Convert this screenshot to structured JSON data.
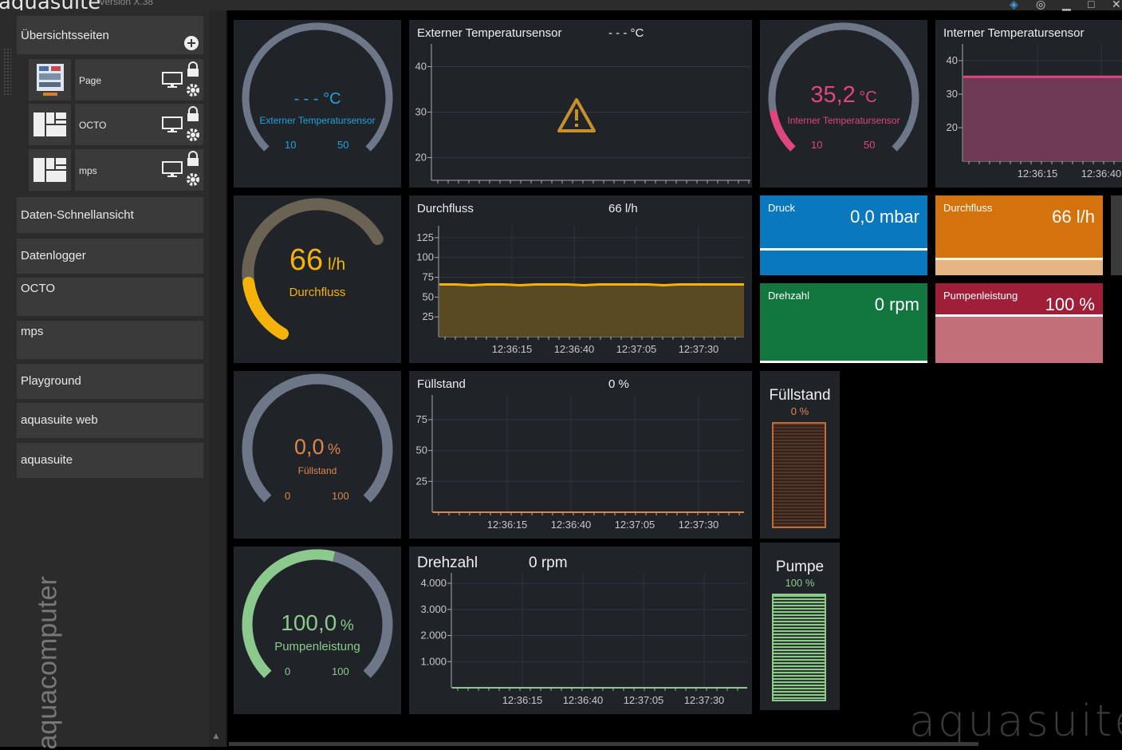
{
  "app": {
    "title": "aquasuite",
    "version": "Version X.38",
    "brand_bottom": "aquasuite",
    "brand_vertical": "aquacomputer"
  },
  "sidebar": {
    "overview_label": "Übersichtsseiten",
    "pages": [
      {
        "label": "Page"
      },
      {
        "label": "OCTO"
      },
      {
        "label": "mps"
      }
    ],
    "items": [
      {
        "label": "Daten-Schnellansicht"
      },
      {
        "label": "Datenlogger"
      },
      {
        "label": "OCTO"
      },
      {
        "label": "mps"
      },
      {
        "label": "Playground"
      },
      {
        "label": "aquasuite web"
      },
      {
        "label": "aquasuite"
      }
    ]
  },
  "gauges": {
    "ext": {
      "value": "- - -",
      "unit": "°C",
      "label": "Externer Temperatursensor",
      "min": "10",
      "max": "50",
      "color": "#1fa3e0"
    },
    "int": {
      "value": "35,2",
      "unit": "°C",
      "label": "Interner Temperatursensor",
      "min": "10",
      "max": "50",
      "color": "#e0457e",
      "fraction": 0.13
    },
    "flow": {
      "value": "66",
      "unit": "l/h",
      "label": "Durchfluss",
      "color": "#f5b20b",
      "fraction": 0.25
    },
    "fill": {
      "value": "0,0",
      "unit": "%",
      "label": "Füllstand",
      "min": "0",
      "max": "100",
      "color": "#e0854a",
      "fraction": 0.0
    },
    "pump": {
      "value": "100,0",
      "unit": "%",
      "label": "Pumpenleistung",
      "min": "0",
      "max": "100",
      "color": "#8cc98c",
      "fraction": 0.55
    }
  },
  "charts": {
    "ext": {
      "title": "Externer Temperatursensor",
      "value": "- - - °C"
    },
    "int": {
      "title": "Interner Temperatursensor"
    },
    "flow": {
      "title": "Durchfluss",
      "value": "66 l/h"
    },
    "fill": {
      "title": "Füllstand",
      "value": "0 %"
    },
    "rpm": {
      "title": "Drehzahl",
      "value": "0 rpm"
    }
  },
  "tiles": {
    "pressure": {
      "label": "Druck",
      "value": "0,0 mbar",
      "color": "#0a78be"
    },
    "flow": {
      "label": "Durchfluss",
      "value": "66 l/h",
      "color": "#d4720b"
    },
    "rpm": {
      "label": "Drehzahl",
      "value": "0 rpm",
      "color": "#12773f"
    },
    "pump": {
      "label": "Pumpenleistung",
      "value": "100 %",
      "color": "#a01f38"
    }
  },
  "bars": {
    "fill": {
      "title": "Füllstand",
      "value": "0 %",
      "color": "#e0854a"
    },
    "pump": {
      "title": "Pumpe",
      "value": "100 %",
      "color": "#8cc98c"
    }
  },
  "chart_data": [
    {
      "type": "line",
      "title": "Externer Temperatursensor",
      "ylim": [
        15,
        45
      ],
      "yticks": [
        20,
        30,
        40
      ],
      "series": [],
      "annotation": "warning (no data)"
    },
    {
      "type": "area",
      "title": "Interner Temperatursensor",
      "x": [
        "12:36:15",
        "12:36:40"
      ],
      "ylim": [
        10,
        45
      ],
      "yticks": [
        20,
        30,
        40
      ],
      "series": [
        {
          "values": [
            35.2,
            35.2,
            35.2,
            35.2,
            35.2
          ]
        }
      ]
    },
    {
      "type": "area",
      "title": "Durchfluss",
      "x": [
        "12:36:15",
        "12:36:40",
        "12:37:05",
        "12:37:30"
      ],
      "ylim": [
        0,
        140
      ],
      "yticks": [
        25,
        50,
        75,
        100,
        125
      ],
      "series": [
        {
          "values": [
            66,
            66,
            65,
            66,
            66,
            65,
            66,
            66,
            66,
            65,
            66,
            66,
            66,
            66,
            65,
            66,
            66,
            66,
            66,
            66
          ]
        }
      ]
    },
    {
      "type": "line",
      "title": "Füllstand",
      "x": [
        "12:36:15",
        "12:36:40",
        "12:37:05",
        "12:37:30"
      ],
      "ylim": [
        0,
        95
      ],
      "yticks": [
        25,
        50,
        75
      ],
      "series": [
        {
          "values": [
            0,
            0,
            0,
            0,
            0,
            0,
            0,
            0
          ]
        }
      ]
    },
    {
      "type": "line",
      "title": "Drehzahl",
      "x": [
        "12:36:15",
        "12:36:40",
        "12:37:05",
        "12:37:30"
      ],
      "ylim": [
        0,
        4400
      ],
      "yticks": [
        1000,
        2000,
        3000,
        4000
      ],
      "ytick_labels": [
        "1.000",
        "2.000",
        "3.000",
        "4.000"
      ],
      "series": [
        {
          "values": [
            0,
            0,
            0,
            0,
            0,
            0,
            0,
            0
          ]
        }
      ]
    }
  ]
}
